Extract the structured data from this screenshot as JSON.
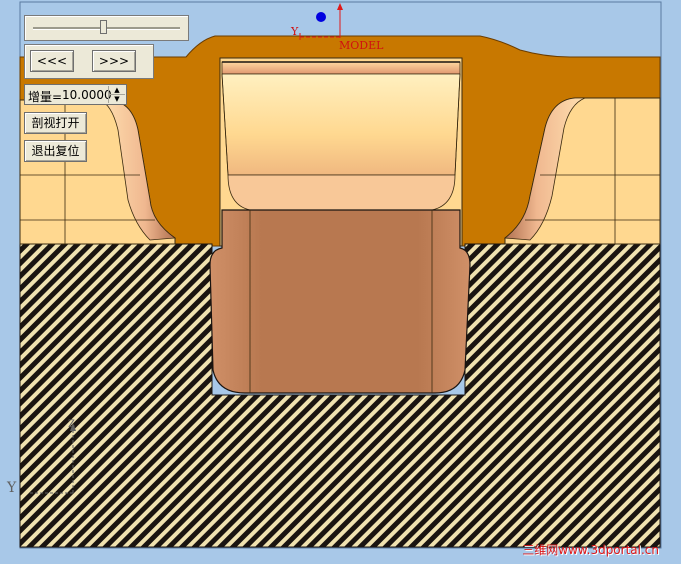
{
  "controls": {
    "prev_label": "<<<",
    "next_label": ">>>",
    "increment_label": "增量=",
    "increment_value": "10.0000",
    "section_open_label": "剖视打开",
    "exit_reset_label": "退出复位"
  },
  "slider": {
    "value_fraction": 0.48
  },
  "model_axes": {
    "y_label": "Y",
    "model_label": "MODEL"
  },
  "view_axes": {
    "y_label": "Y",
    "z_label": "Z"
  },
  "watermark": "三维网www.3dportal.cn",
  "colors": {
    "background": "#a8c8e8",
    "mold_orange": "#c87800",
    "cavity_light": "#ffd890",
    "cavity_shadow": "#b87850",
    "hatch_dark": "#1a1410",
    "hatch_light": "#f0e2b0",
    "axis_red": "#e01818",
    "axis_blue": "#0000e0"
  }
}
